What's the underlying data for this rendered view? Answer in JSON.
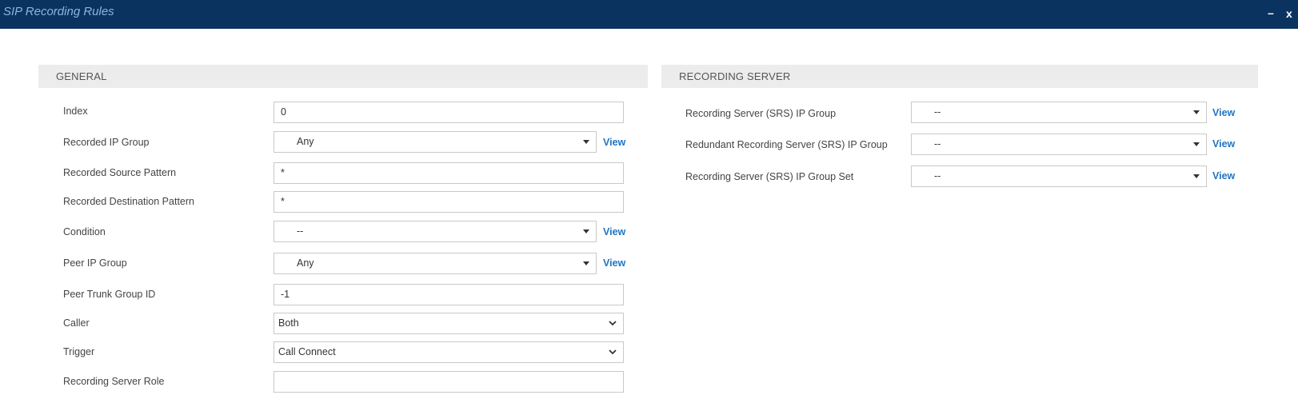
{
  "window": {
    "title": "SIP Recording Rules",
    "minimize_label": "–",
    "close_label": "x"
  },
  "general": {
    "header": "GENERAL",
    "fields": {
      "index": {
        "label": "Index",
        "value": "0"
      },
      "recorded_ip_group": {
        "label": "Recorded IP Group",
        "value": "Any",
        "view": "View"
      },
      "recorded_source_pattern": {
        "label": "Recorded Source Pattern",
        "value": "*"
      },
      "recorded_destination_pattern": {
        "label": "Recorded Destination Pattern",
        "value": "*"
      },
      "condition": {
        "label": "Condition",
        "value": "--",
        "view": "View"
      },
      "peer_ip_group": {
        "label": "Peer IP Group",
        "value": "Any",
        "view": "View"
      },
      "peer_trunk_group_id": {
        "label": "Peer Trunk Group ID",
        "value": "-1"
      },
      "caller": {
        "label": "Caller",
        "value": "Both"
      },
      "trigger": {
        "label": "Trigger",
        "value": "Call Connect"
      },
      "recording_server_role": {
        "label": "Recording Server Role",
        "value": ""
      }
    }
  },
  "recording_server": {
    "header": "RECORDING SERVER",
    "fields": {
      "srs_ip_group": {
        "label": "Recording Server (SRS) IP Group",
        "value": "--",
        "view": "View"
      },
      "redundant_srs_ip_group": {
        "label": "Redundant Recording Server (SRS) IP Group",
        "value": "--",
        "view": "View"
      },
      "srs_ip_group_set": {
        "label": "Recording Server (SRS) IP Group Set",
        "value": "--",
        "view": "View"
      }
    }
  },
  "icons": {
    "dropdown_caret": "caret-down-icon",
    "select_chevron": "chevron-down-icon"
  },
  "colors": {
    "titlebar_bg": "#0b3360",
    "title_text": "#8fb4e3",
    "section_bg": "#ececec",
    "link": "#1f75c4"
  }
}
